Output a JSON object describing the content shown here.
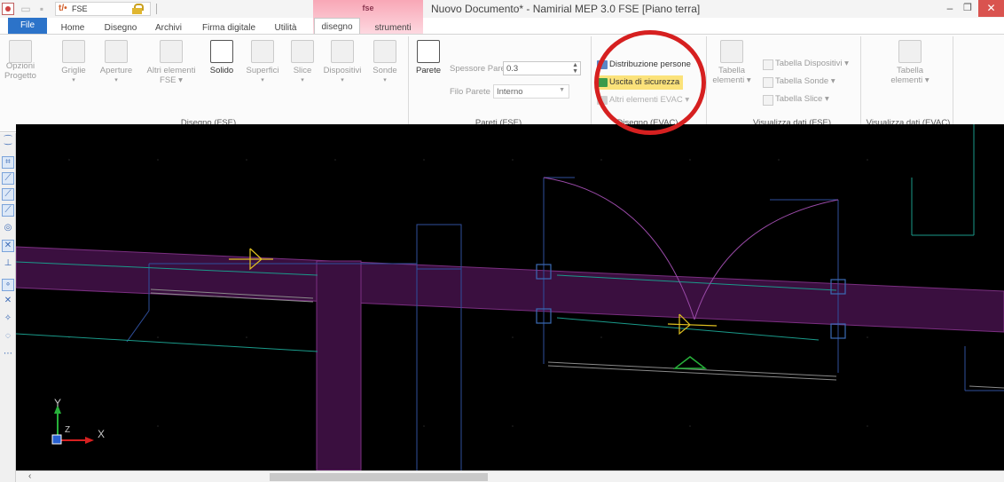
{
  "titlebar": {
    "profile_combo_text": "FSE",
    "context_tab_group": "fse",
    "window_title": "Nuovo Documento* - Namirial MEP 3.0 FSE [Piano terra]"
  },
  "tabs": {
    "file": "File",
    "home": "Home",
    "disegno": "Disegno",
    "archivi": "Archivi",
    "firma": "Firma digitale",
    "utilita": "Utilità",
    "ctx_disegno": "disegno",
    "ctx_strumenti": "strumenti"
  },
  "ribbon": {
    "disegno_fse": {
      "label": "Disegno (FSE)",
      "opzioni_line1": "Opzioni",
      "opzioni_line2": "Progetto",
      "griglie": "Griglie",
      "aperture": "Aperture",
      "altri_line1": "Altri elementi",
      "altri_line2": "FSE",
      "solido": "Solido",
      "superfici": "Superfici",
      "slice": "Slice",
      "dispositivi": "Dispositivi",
      "sonde": "Sonde"
    },
    "pareti_fse": {
      "label": "Pareti (FSE)",
      "parete": "Parete",
      "spessore_label": "Spessore Parete",
      "spessore_value": "0.3",
      "filo_label": "Filo Parete",
      "filo_value": "Interno"
    },
    "disegno_evac": {
      "label": "Disegno (EVAC)",
      "distribuzione": "Distribuzione persone",
      "uscita": "Uscita di sicurezza",
      "altri": "Altri elementi EVAC"
    },
    "visualizza_fse": {
      "label": "Visualizza dati (FSE)",
      "tabella_line1": "Tabella",
      "tabella_line2": "elementi",
      "tab_dispositivi": "Tabella Dispositivi",
      "tab_sonde": "Tabella Sonde",
      "tab_slice": "Tabella Slice"
    },
    "visualizza_evac": {
      "label": "Visualizza dati (EVAC)",
      "tabella_line1": "Tabella",
      "tabella_line2": "elementi"
    }
  },
  "canvas": {
    "background": "#000000",
    "wall_fill": "#3a0f3f",
    "ucs_y": "Y",
    "ucs_x": "X",
    "ucs_z": "Z"
  },
  "colors": {
    "file_tab": "#2c73c9",
    "context_tab": "#f8a7b6",
    "highlight": "#fbe27a",
    "annotation": "#d62020"
  }
}
